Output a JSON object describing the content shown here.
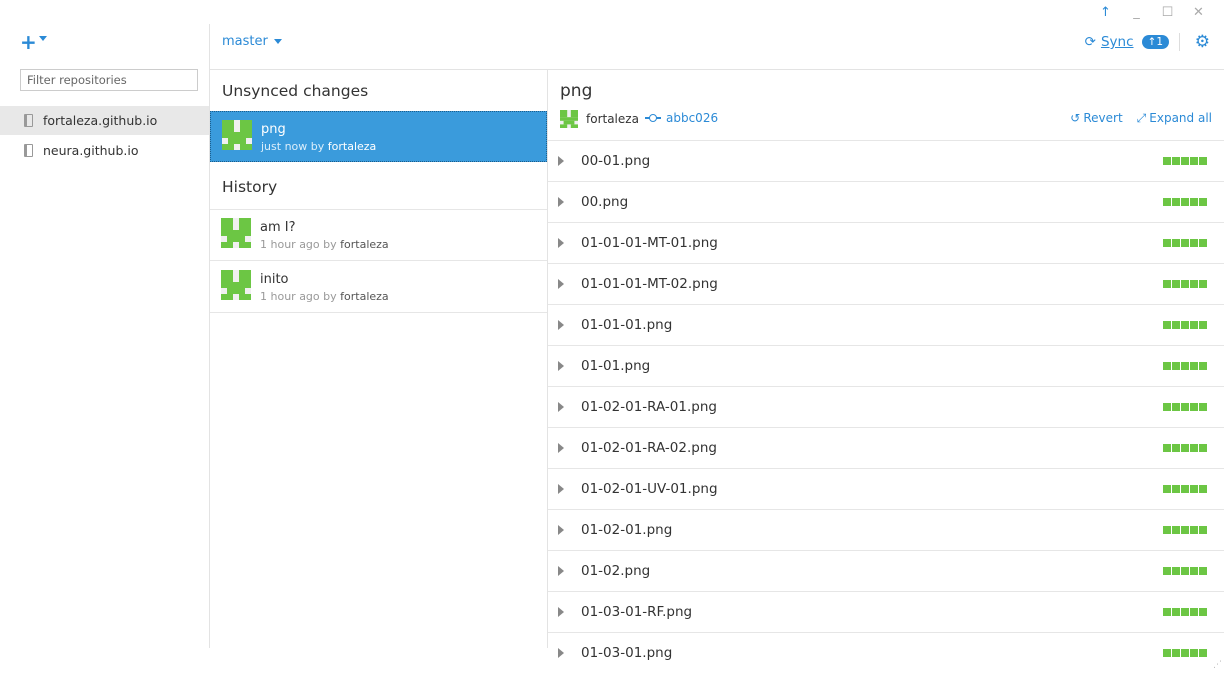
{
  "window": {
    "controls": [
      "↑",
      "_",
      "☐",
      "✕"
    ]
  },
  "sidebar": {
    "add_icon": "+",
    "filter_placeholder": "Filter repositories",
    "repos": [
      {
        "label": "fortaleza.github.io",
        "active": true
      },
      {
        "label": "neura.github.io",
        "active": false
      }
    ]
  },
  "header": {
    "branch": "master",
    "sync_label": "Sync",
    "sync_badge": "↑1",
    "sync_icon": "refresh-icon",
    "settings_icon": "gear-icon"
  },
  "commits": {
    "unsynced_title": "Unsynced changes",
    "history_title": "History",
    "unsynced": [
      {
        "message": "png",
        "time": "just now by ",
        "author": "fortaleza"
      }
    ],
    "history": [
      {
        "message": "am I?",
        "time": "1 hour ago by ",
        "author": "fortaleza"
      },
      {
        "message": "inito",
        "time": "1 hour ago by ",
        "author": "fortaleza"
      }
    ]
  },
  "detail": {
    "title": "png",
    "author": "fortaleza",
    "sha": "abbc026",
    "revert_label": "Revert",
    "expand_label": "Expand all",
    "files": [
      "00-01.png",
      "00.png",
      "01-01-01-MT-01.png",
      "01-01-01-MT-02.png",
      "01-01-01.png",
      "01-01.png",
      "01-02-01-RA-01.png",
      "01-02-01-RA-02.png",
      "01-02-01-UV-01.png",
      "01-02-01.png",
      "01-02.png",
      "01-03-01-RF.png",
      "01-03-01.png"
    ]
  },
  "colors": {
    "accent": "#2b8ad6",
    "selected": "#3a9bdc",
    "addition": "#6cc644"
  }
}
